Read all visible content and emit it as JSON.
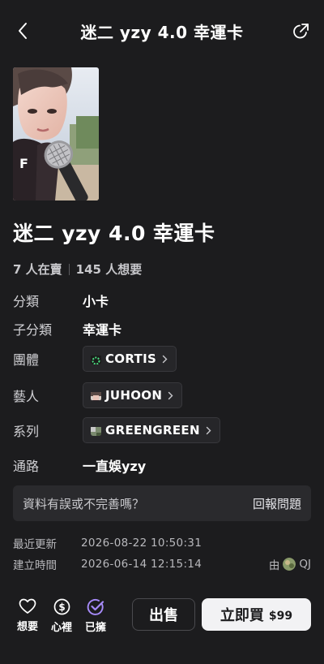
{
  "header": {
    "title": "迷二 yzy 4.0 幸運卡"
  },
  "item": {
    "title": "迷二 yzy 4.0 幸運卡",
    "selling": "7 人在賣",
    "wanting": "145 人想要"
  },
  "details": {
    "category_label": "分類",
    "category_value": "小卡",
    "subcategory_label": "子分類",
    "subcategory_value": "幸運卡",
    "group_label": "團體",
    "group_value": "CORTIS",
    "artist_label": "藝人",
    "artist_value": "JUHOON",
    "series_label": "系列",
    "series_value": "GREENGREEN",
    "channel_label": "通路",
    "channel_value": "一直娛yzy"
  },
  "report": {
    "question": "資料有誤或不完善嗎？",
    "link": "回報問題"
  },
  "meta": {
    "updated_label": "最近更新",
    "updated_value": "2026-08-22 10:50:31",
    "created_label": "建立時間",
    "created_value": "2026-06-14 12:15:14",
    "creator_prefix": "由",
    "creator_name": "QJ"
  },
  "actions": {
    "want_label": "想要",
    "wishlist_label": "心裡",
    "owned_label": "已擁",
    "sell_label": "出售",
    "buy_label": "立即買",
    "buy_price": "$99"
  },
  "icons": {
    "back": "chevron-left-icon",
    "share": "share-icon",
    "want": "heart-icon",
    "wishlist": "dollar-circle-icon",
    "owned": "check-circle-icon"
  },
  "colors": {
    "background": "#1c1c1e",
    "owned_accent": "#a78bfa",
    "buy_button": "#f2f2f4"
  }
}
